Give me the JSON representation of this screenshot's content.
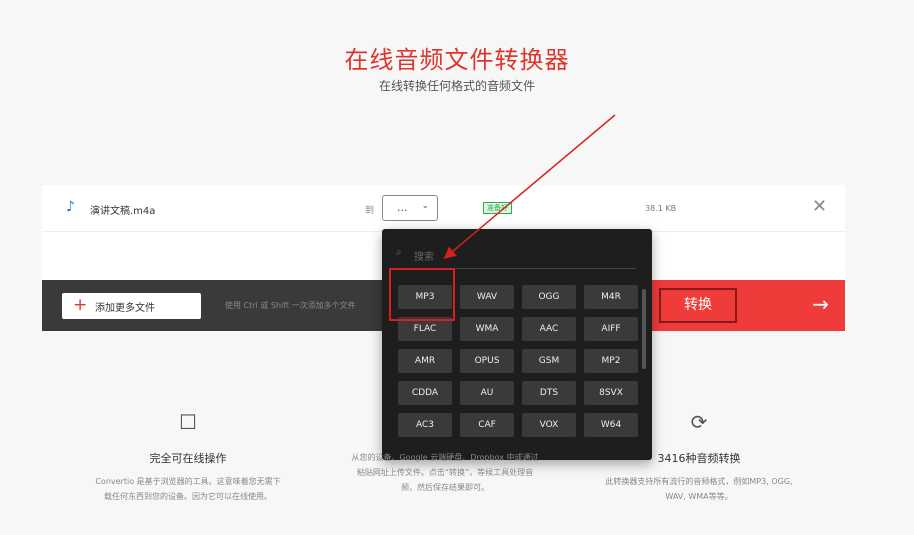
{
  "header": {
    "title": "在线音频文件转换器",
    "subtitle": "在线转换任何格式的音频文件"
  },
  "file": {
    "name": "演讲文稿.m4a",
    "to_label": "到",
    "selected_format": "...",
    "status": "准备好",
    "size": "38.1 KB"
  },
  "toolbar": {
    "add_label": "添加更多文件",
    "hint": "使用 Ctrl 或 Shift 一次添加多个文件",
    "convert_label": "转换",
    "convert_arrow": "→"
  },
  "dropdown": {
    "search_placeholder": "搜索",
    "formats": [
      "MP3",
      "WAV",
      "OGG",
      "M4R",
      "FLAC",
      "WMA",
      "AAC",
      "AIFF",
      "AMR",
      "OPUS",
      "GSM",
      "MP2",
      "CDDA",
      "AU",
      "DTS",
      "8SVX",
      "AC3",
      "CAF",
      "VOX",
      "W64"
    ]
  },
  "features": [
    {
      "icon": "pointer-icon",
      "title": "完全可在线操作",
      "desc": "Convertio 是基于浏览器的工具。这意味着您无需下载任何东西到您的设备。因为它可以在线使用。"
    },
    {
      "icon": "cloud-icon",
      "title": "",
      "desc": "从您的设备、Google 云端硬盘、Dropbox 中或通过粘贴网址上传文件。点击“转换”，等候工具处理音频，然后保存结果即可。"
    },
    {
      "icon": "refresh-icon",
      "title": "3416种音频转换",
      "desc": "此转换器支持所有流行的音频格式，例如MP3, OGG, WAV, WMA等等。"
    }
  ],
  "colors": {
    "accent": "#e0352c",
    "convert_bg": "#f03b3b",
    "dropdown_bg": "#1e1e1e"
  }
}
